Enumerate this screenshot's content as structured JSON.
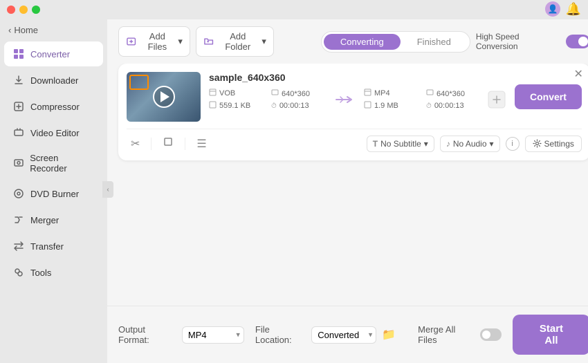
{
  "titlebar": {
    "traffic_lights": [
      "red",
      "yellow",
      "green"
    ]
  },
  "sidebar": {
    "home_label": "Home",
    "home_arrow": "‹",
    "items": [
      {
        "id": "converter",
        "label": "Converter",
        "icon": "⊞",
        "active": true
      },
      {
        "id": "downloader",
        "label": "Downloader",
        "icon": "↓"
      },
      {
        "id": "compressor",
        "label": "Compressor",
        "icon": "⊡"
      },
      {
        "id": "video-editor",
        "label": "Video Editor",
        "icon": "✂"
      },
      {
        "id": "screen-recorder",
        "label": "Screen Recorder",
        "icon": "⊙"
      },
      {
        "id": "dvd-burner",
        "label": "DVD Burner",
        "icon": "⊗"
      },
      {
        "id": "merger",
        "label": "Merger",
        "icon": "⊕"
      },
      {
        "id": "transfer",
        "label": "Transfer",
        "icon": "⇄"
      },
      {
        "id": "tools",
        "label": "Tools",
        "icon": "⚙"
      }
    ]
  },
  "toolbar": {
    "add_file_label": "Add Files",
    "add_btn_arrow": "▾",
    "add_folder_label": "Add Folder",
    "add_folder_arrow": "▾"
  },
  "tabs": {
    "converting_label": "Converting",
    "finished_label": "Finished",
    "active": "converting"
  },
  "speed": {
    "label": "High Speed Conversion",
    "enabled": true
  },
  "file_card": {
    "filename": "sample_640x360",
    "source": {
      "format": "VOB",
      "resolution": "640*360",
      "size": "559.1 KB",
      "duration": "00:00:13"
    },
    "output": {
      "format": "MP4",
      "resolution": "640*360",
      "size": "1.9 MB",
      "duration": "00:00:13"
    },
    "subtitle": "No Subtitle",
    "audio": "No Audio",
    "convert_btn": "Convert",
    "settings_btn": "Settings"
  },
  "bottom": {
    "output_format_label": "Output Format:",
    "output_format_value": "MP4",
    "file_location_label": "File Location:",
    "file_location_value": "Converted",
    "merge_label": "Merge All Files",
    "start_all_label": "Start All"
  },
  "icons": {
    "user": "👤",
    "bell": "🔔",
    "play": "▶",
    "close": "✕",
    "scissors": "✂",
    "crop": "⊡",
    "adjust": "☰",
    "info": "i",
    "gear": "⚙",
    "folder": "📁",
    "subtitle_icon": "T",
    "audio_icon": "♪",
    "arrow_right": "→"
  }
}
